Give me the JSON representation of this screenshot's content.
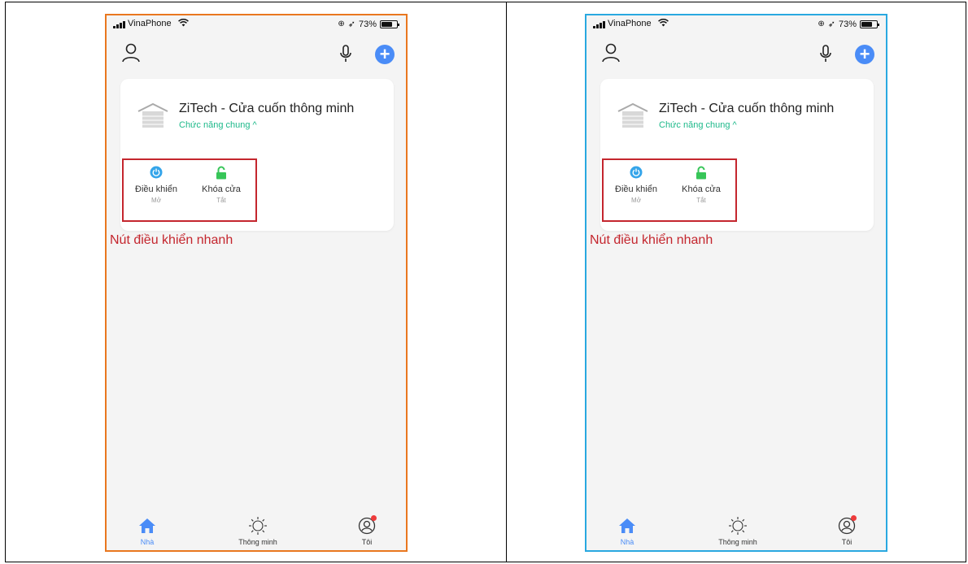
{
  "colors": {
    "left_frame": "#e9771f",
    "right_frame": "#29a8e0",
    "accent_blue": "#4a8cf7",
    "accent_green": "#1db98a",
    "highlight_red": "#c4262e"
  },
  "screens": [
    {
      "status": {
        "carrier": "VinaPhone",
        "battery": "73%",
        "battery_level": 0.73
      },
      "card": {
        "device_name": "ZiTech - Cửa cuốn thông minh",
        "subtitle": "Chức năng chung ^",
        "actions": [
          {
            "label": "Điều khiển",
            "state": "Mở",
            "icon": "power-icon"
          },
          {
            "label": "Khóa cửa",
            "state": "Tắt",
            "icon": "lock-icon"
          }
        ]
      },
      "annotation": "Nút điều khiển nhanh",
      "tabs": [
        {
          "label": "Nhà",
          "icon": "home-icon"
        },
        {
          "label": "Thông minh",
          "icon": "sun-icon"
        },
        {
          "label": "Tôi",
          "icon": "profile-icon"
        }
      ]
    },
    {
      "status": {
        "carrier": "VinaPhone",
        "battery": "73%",
        "battery_level": 0.73
      },
      "card": {
        "device_name": "ZiTech - Cửa cuốn thông minh",
        "subtitle": "Chức năng chung ^",
        "actions": [
          {
            "label": "Điều khiển",
            "state": "Mở",
            "icon": "power-icon"
          },
          {
            "label": "Khóa cửa",
            "state": "Tắt",
            "icon": "lock-icon"
          }
        ]
      },
      "annotation": "Nút điều khiển nhanh",
      "tabs": [
        {
          "label": "Nhà",
          "icon": "home-icon"
        },
        {
          "label": "Thông minh",
          "icon": "sun-icon"
        },
        {
          "label": "Tôi",
          "icon": "profile-icon"
        }
      ]
    }
  ]
}
